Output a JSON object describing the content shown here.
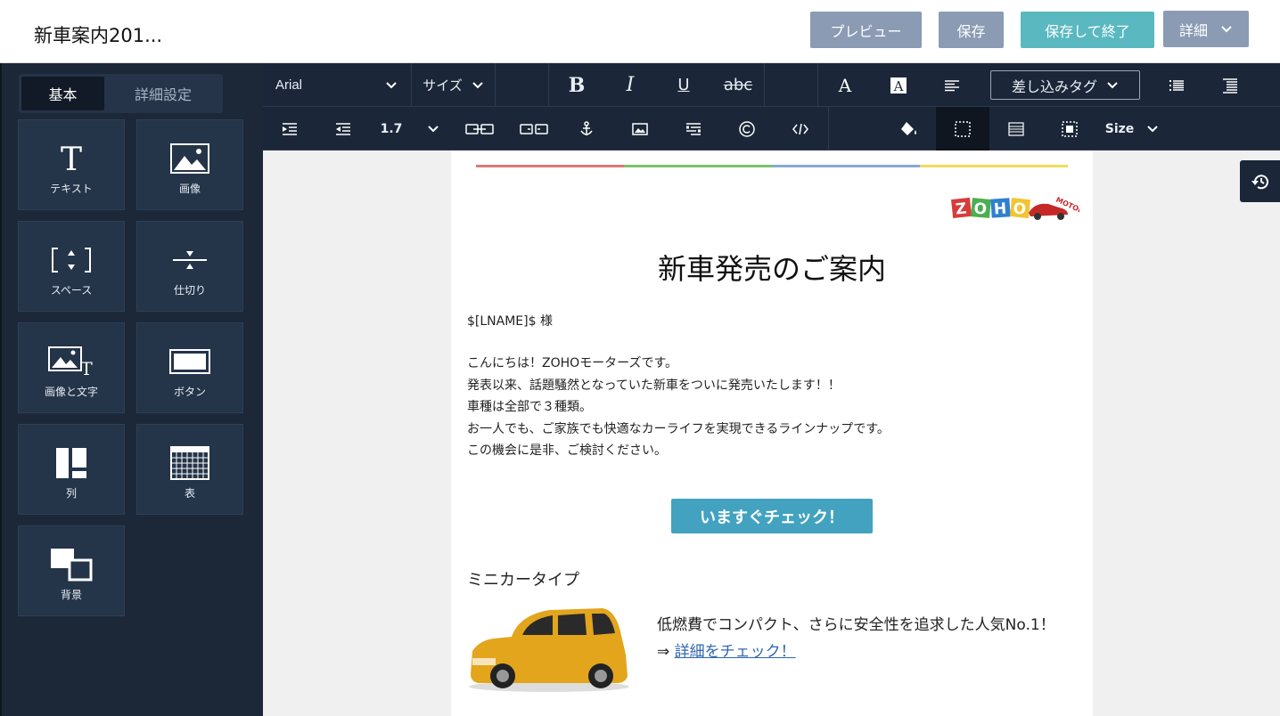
{
  "header": {
    "title": "新車案内201...",
    "preview_label": "プレビュー",
    "save_label": "保存",
    "save_exit_label": "保存して終了",
    "more_label": "詳細"
  },
  "sidebar": {
    "tabs": [
      "基本",
      "詳細設定"
    ],
    "tiles": [
      {
        "label": "テキスト",
        "icon": "text-icon"
      },
      {
        "label": "画像",
        "icon": "image-icon"
      },
      {
        "label": "スペース",
        "icon": "space-icon"
      },
      {
        "label": "仕切り",
        "icon": "divider-icon"
      },
      {
        "label": "画像と文字",
        "icon": "image-text-icon"
      },
      {
        "label": "ボタン",
        "icon": "button-icon"
      },
      {
        "label": "列",
        "icon": "columns-icon"
      },
      {
        "label": "表",
        "icon": "table-icon"
      },
      {
        "label": "背景",
        "icon": "background-icon"
      }
    ]
  },
  "toolbar": {
    "font": "Arial",
    "size": "サイズ",
    "bold": "B",
    "italic": "I",
    "underline": "U",
    "strike": "abc",
    "merge_tags": "差し込みタグ",
    "line_height": "1.7",
    "size_en": "Size",
    "icons": [
      "font-color-icon",
      "bg-color-icon",
      "align-icon",
      "bullet-list-icon",
      "number-list-icon",
      "indent-icon",
      "outdent-icon",
      "link-icon",
      "unlink-icon",
      "anchor-icon",
      "insert-image-icon",
      "paragraph-icon",
      "copyright-icon",
      "code-icon",
      "fill-icon",
      "border-icon",
      "table-style-icon",
      "select-icon"
    ]
  },
  "email": {
    "logo_text": "ZOHO",
    "logo_sub": "MOTORS",
    "heading": "新車発売のご案内",
    "greeting": "$[LNAME]$ 様",
    "body": [
      "こんにちは！ZOHOモーターズです。",
      "発表以来、話題騒然となっていた新車をついに発売いたします！！",
      "車種は全部で３種類。",
      "お一人でも、ご家族でも快適なカーライフを実現できるラインナップです。",
      "この機会に是非、ご検討ください。"
    ],
    "cta": "いますぐチェック！",
    "section_title": "ミニカータイプ",
    "product_desc": "低燃費でコンパクト、さらに安全性を追求した人気No.1！",
    "link_prefix": "⇒",
    "link_text": "詳細をチェック！"
  },
  "colors": {
    "accent_teal": "#5ab8c0",
    "button_grey": "#8a9bb3",
    "cta_blue": "#42a2c0",
    "rainbow": [
      "#d97b7b",
      "#7dc36b",
      "#89a9d6",
      "#f0dc5c"
    ]
  }
}
